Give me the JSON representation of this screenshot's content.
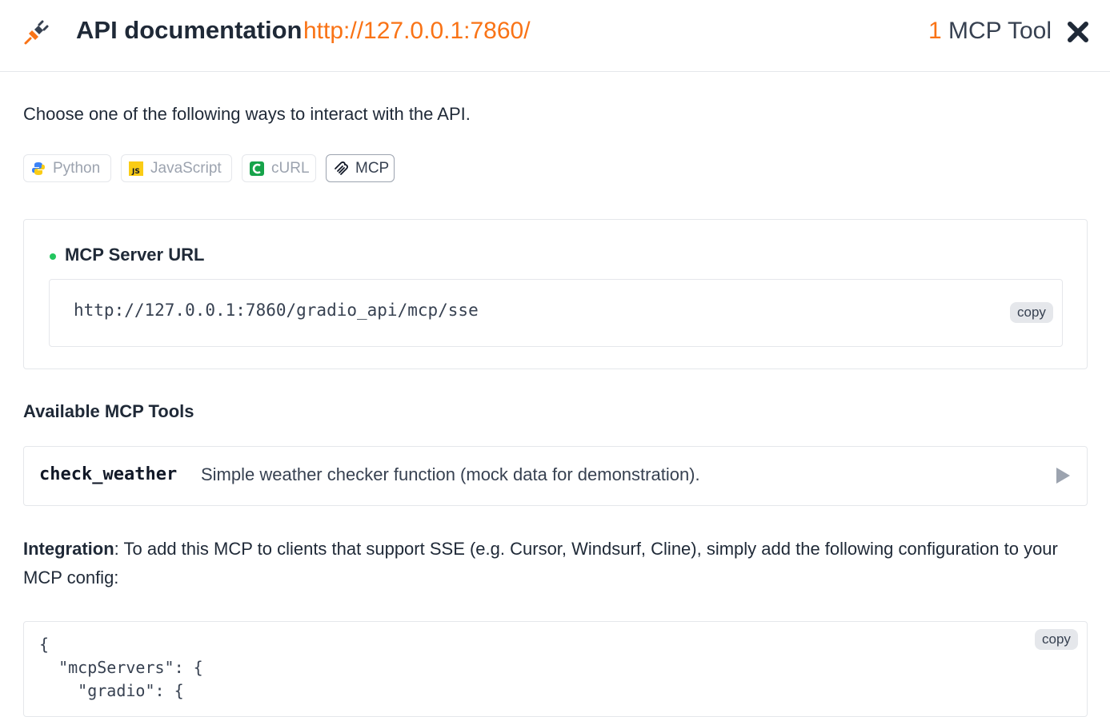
{
  "header": {
    "title": "API documentation",
    "url": "http://127.0.0.1:7860/",
    "tool_count": "1",
    "tool_count_label": "MCP Tool"
  },
  "intro": "Choose one of the following ways to interact with the API.",
  "tabs": [
    {
      "label": "Python",
      "icon": "python-icon",
      "active": false
    },
    {
      "label": "JavaScript",
      "icon": "javascript-icon",
      "active": false
    },
    {
      "label": "cURL",
      "icon": "curl-icon",
      "active": false
    },
    {
      "label": "MCP",
      "icon": "mcp-icon",
      "active": true
    }
  ],
  "server": {
    "label": "MCP Server URL",
    "url": "http://127.0.0.1:7860/gradio_api/mcp/sse",
    "copy_label": "copy"
  },
  "tools_heading": "Available MCP Tools",
  "tools": [
    {
      "name": "check_weather",
      "description": "Simple weather checker function (mock data for demonstration)."
    }
  ],
  "integration": {
    "label": "Integration",
    "text": ": To add this MCP to clients that support SSE (e.g. Cursor, Windsurf, Cline), simply add the following configuration to your MCP config:"
  },
  "config": {
    "copy_label": "copy",
    "code": "{\n  \"mcpServers\": {\n    \"gradio\": {"
  },
  "colors": {
    "accent": "#f97316",
    "status_dot": "#22c55e",
    "border": "#e5e7eb"
  }
}
